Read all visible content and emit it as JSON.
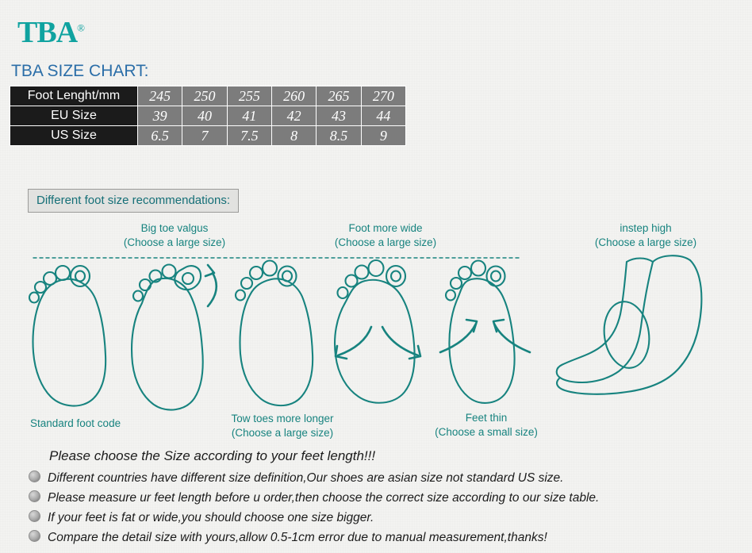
{
  "brand": {
    "name": "TBA",
    "registered": "®"
  },
  "title": "TBA SIZE CHART:",
  "table": {
    "rows": [
      {
        "header": "Foot Lenght/mm",
        "values": [
          "245",
          "250",
          "255",
          "260",
          "265",
          "270"
        ]
      },
      {
        "header": "EU  Size",
        "values": [
          "39",
          "40",
          "41",
          "42",
          "43",
          "44"
        ]
      },
      {
        "header": "US  Size",
        "values": [
          "6.5",
          "7",
          "7.5",
          "8",
          "8.5",
          "9"
        ]
      }
    ]
  },
  "reco_box_label": "Different  foot  size  recommendations:",
  "illustrations": [
    {
      "name": "standard-foot",
      "caption_bottom": "Standard  foot  code",
      "caption_top": ""
    },
    {
      "name": "big-toe-valgus",
      "caption_top_line1": "Big toe valgus",
      "caption_top_line2": "(Choose a large size)"
    },
    {
      "name": "two-toes-longer",
      "caption_bottom_line1": "Tow toes more longer",
      "caption_bottom_line2": "(Choose a large size)"
    },
    {
      "name": "foot-more-wide",
      "caption_top_line1": "Foot more wide",
      "caption_top_line2": "(Choose a large size)"
    },
    {
      "name": "feet-thin",
      "caption_bottom_line1": "Feet  thin",
      "caption_bottom_line2": "(Choose a small size)"
    },
    {
      "name": "instep-high",
      "caption_top_line1": "instep high",
      "caption_top_line2": "(Choose a large size)"
    }
  ],
  "notes": {
    "heading": "Please choose the Size according to  your feet length!!!",
    "items": [
      "Different countries have different size definition,Our shoes are asian size not standard US size.",
      "Please measure ur feet length before u order,then choose the correct size according to our size table.",
      "If your feet is fat or wide,you should choose one size bigger.",
      "Compare the detail size with yours,allow 0.5-1cm error due to manual measurement,thanks!"
    ]
  },
  "colors": {
    "teal": "#17837f",
    "title_blue": "#2b6ea8",
    "table_head": "#1b1b1b",
    "table_cell": "#7c7c7c"
  }
}
